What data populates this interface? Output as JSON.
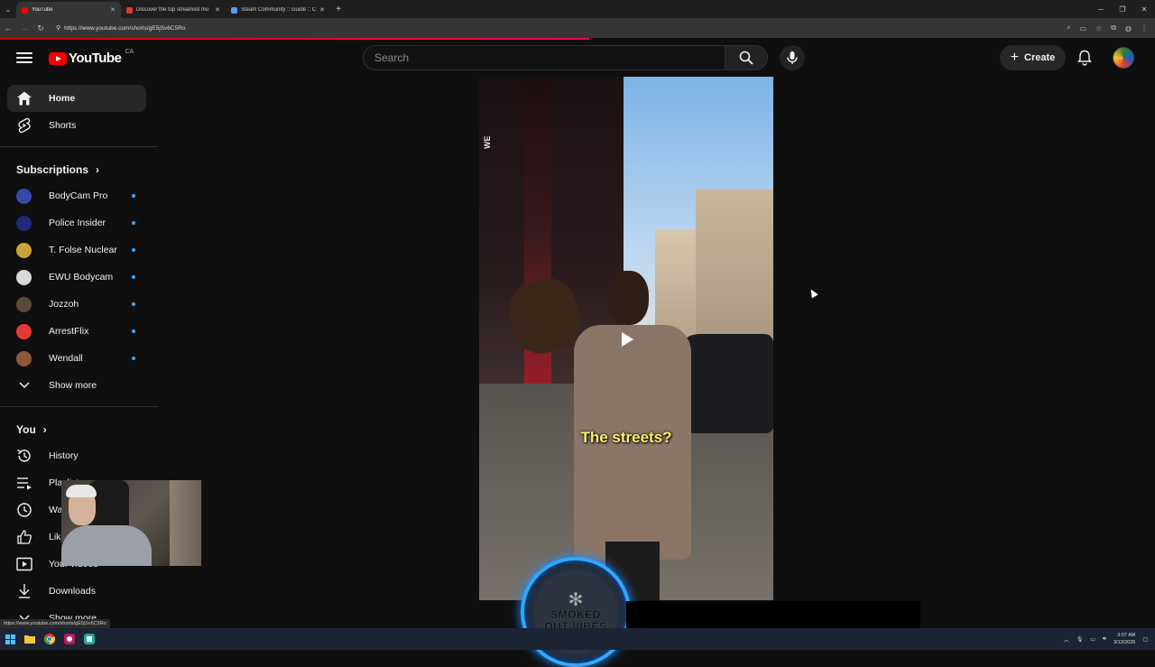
{
  "browser": {
    "tabs": [
      {
        "label": "YouTube",
        "favicon_color": "#ff0000",
        "active": true
      },
      {
        "label": "Discover the top streamed mu",
        "favicon_color": "#e53935",
        "active": false
      },
      {
        "label": "Steam Community :: Guide :: C",
        "favicon_color": "#4aa3ff",
        "active": false
      }
    ],
    "url": "https://www.youtube.com/shorts/gE5jSv6C5Ro",
    "status_url": "https://www.youtube.com/shorts/gE5jSv6C5Ro",
    "load_progress": 0.51
  },
  "masthead": {
    "logo_text": "YouTube",
    "country_code": "CA",
    "search_placeholder": "Search",
    "create_label": "Create"
  },
  "sidebar": {
    "primary": [
      {
        "label": "Home",
        "icon": "home-icon",
        "active": true
      },
      {
        "label": "Shorts",
        "icon": "shorts-icon",
        "active": false
      }
    ],
    "subscriptions_title": "Subscriptions",
    "subscriptions": [
      {
        "label": "BodyCam Pro",
        "avatar_color": "#3949ab"
      },
      {
        "label": "Police Insider",
        "avatar_color": "#1e2a78"
      },
      {
        "label": "T. Folse Nuclear",
        "avatar_color": "#c8a23a"
      },
      {
        "label": "EWU Bodycam",
        "avatar_color": "#d9d9d9"
      },
      {
        "label": "Jozzoh",
        "avatar_color": "#5a4a3a"
      },
      {
        "label": "ArrestFlix",
        "avatar_color": "#e53935"
      },
      {
        "label": "Wendall",
        "avatar_color": "#8d5a3b"
      }
    ],
    "show_more_label": "Show more",
    "you_title": "You",
    "you_items": [
      {
        "label": "History",
        "icon": "history-icon"
      },
      {
        "label": "Playlists",
        "icon": "playlist-icon"
      },
      {
        "label": "Watch later",
        "icon": "watch-later-icon"
      },
      {
        "label": "Liked videos",
        "icon": "thumbs-up-icon"
      },
      {
        "label": "Your videos",
        "icon": "your-videos-icon"
      },
      {
        "label": "Downloads",
        "icon": "download-icon"
      }
    ],
    "you_show_more_label": "Show more"
  },
  "short": {
    "caption": "The streets?",
    "sign_text": "WE"
  },
  "overlay": {
    "stream_logo_line1": "SMOKED",
    "stream_logo_line2": "OUT VIBES"
  },
  "taskbar": {
    "time": "3:07 AM",
    "date": "3/13/2026"
  }
}
